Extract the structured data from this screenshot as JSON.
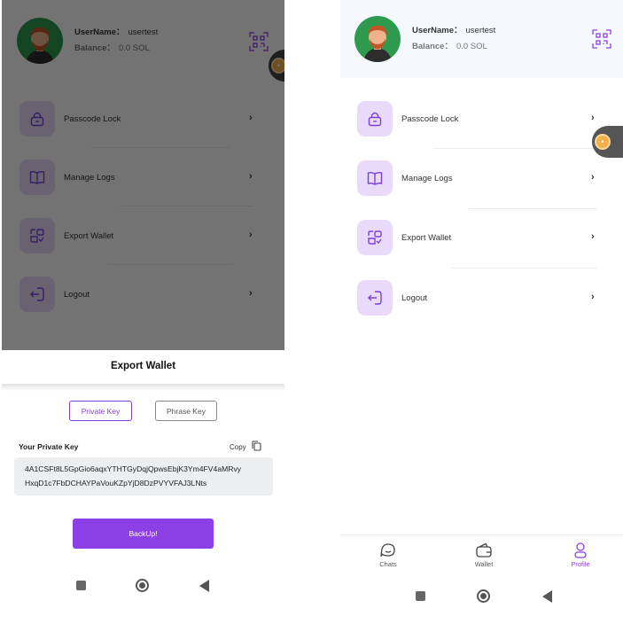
{
  "profile": {
    "username_label": "UserName：",
    "username_value": "usertest",
    "balance_label": "Balance：",
    "balance_value": "0.0 SOL"
  },
  "menu": {
    "items": [
      {
        "label": "Passcode Lock",
        "icon": "lock-icon"
      },
      {
        "label": "Manage Logs",
        "icon": "book-icon"
      },
      {
        "label": "Export Wallet",
        "icon": "export-icon"
      },
      {
        "label": "Logout",
        "icon": "logout-icon"
      }
    ]
  },
  "export_sheet": {
    "title": "Export Wallet",
    "tab_private": "Private Key",
    "tab_phrase": "Phrase Key",
    "key_label": "Your Private Key",
    "copy_label": "Copy",
    "private_key_line1": "4A1CSFt8L5GpGio6aqxYTHTGyDqjQpwsEbjK3Ym4FV4aMRvy",
    "private_key_line2": "HxqD1c7FbDCHAYPaVouKZpYjD8DzPVYVFAJ3LNts",
    "backup_label": "BackUp!"
  },
  "bottom_nav": {
    "chats": "Chats",
    "wallet": "Wallet",
    "profile": "Profile",
    "active": "Profile"
  },
  "colors": {
    "accent": "#8d3fe6",
    "icon_bg": "#e8daf8",
    "avatar_bg": "#2e9a4e"
  }
}
